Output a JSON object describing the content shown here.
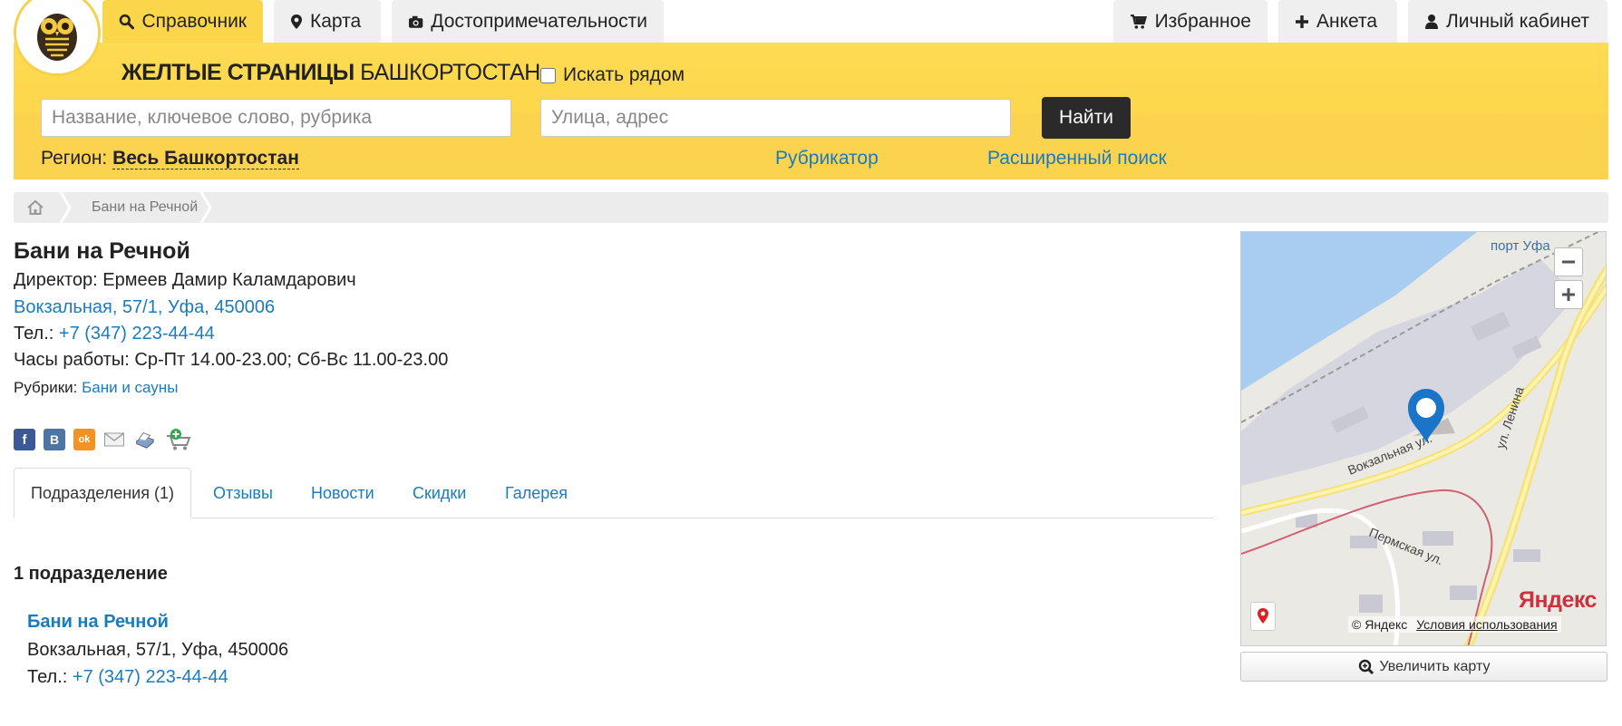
{
  "nav": {
    "tabs": [
      {
        "label": "Справочник",
        "icon": "search-icon"
      },
      {
        "label": "Карта",
        "icon": "map-pin-icon"
      },
      {
        "label": "Достопримечательности",
        "icon": "camera-icon"
      }
    ],
    "right_tabs": [
      {
        "label": "Избранное",
        "icon": "cart-icon"
      },
      {
        "label": "Анкета",
        "icon": "plus-icon"
      },
      {
        "label": "Личный кабинет",
        "icon": "user-icon"
      }
    ]
  },
  "header": {
    "brand_bold": "ЖЕЛТЫЕ СТРАНИЦЫ",
    "brand_light": "БАШКОРТОСТАН",
    "nearby_label": "Искать рядом",
    "search_placeholder": "Название, ключевое слово, рубрика",
    "address_placeholder": "Улица, адрес",
    "find_button": "Найти",
    "region_label": "Регион:",
    "region_value": "Весь Башкортостан",
    "rubricator_link": "Рубрикатор",
    "advanced_link": "Расширенный поиск"
  },
  "breadcrumb": {
    "current": "Бани на Речной"
  },
  "company": {
    "name": "Бани на Речной",
    "director": "Директор: Ермеев Дамир Каламдарович",
    "address": "Вокзальная, 57/1, Уфа, 450006",
    "phone_label": "Тел.:",
    "phone": "+7 (347) 223-44-44",
    "hours": "Часы работы: Ср-Пт 14.00-23.00; Сб-Вс 11.00-23.00",
    "rubrics_label": "Рубрики:",
    "rubric": "Бани и сауны"
  },
  "social": {
    "facebook": "f",
    "vkontakte": "B",
    "odnoklassniki": "ok"
  },
  "tabs": [
    "Подразделения (1)",
    "Отзывы",
    "Новости",
    "Скидки",
    "Галерея"
  ],
  "subdivisions": {
    "heading": "1 подразделение",
    "items": [
      {
        "name": "Бани на Речной",
        "address": "Вокзальная, 57/1, Уфа, 450006",
        "phone_label": "Тел.:",
        "phone": "+7 (347) 223-44-44"
      }
    ]
  },
  "map": {
    "labels": {
      "port": "порт Уфа",
      "street1": "Вокзальная ул.",
      "street2": "ул. Ленина",
      "street3": "Пермская ул."
    },
    "yandex_logo": "Яндекс",
    "copyright": "© Яндекс",
    "terms_link": "Условия использования",
    "enlarge_button": "Увеличить карту"
  },
  "colors": {
    "brand_yellow": "#fbd54a",
    "link_blue": "#1a7bbf",
    "dark_button": "#2a2a2a"
  }
}
